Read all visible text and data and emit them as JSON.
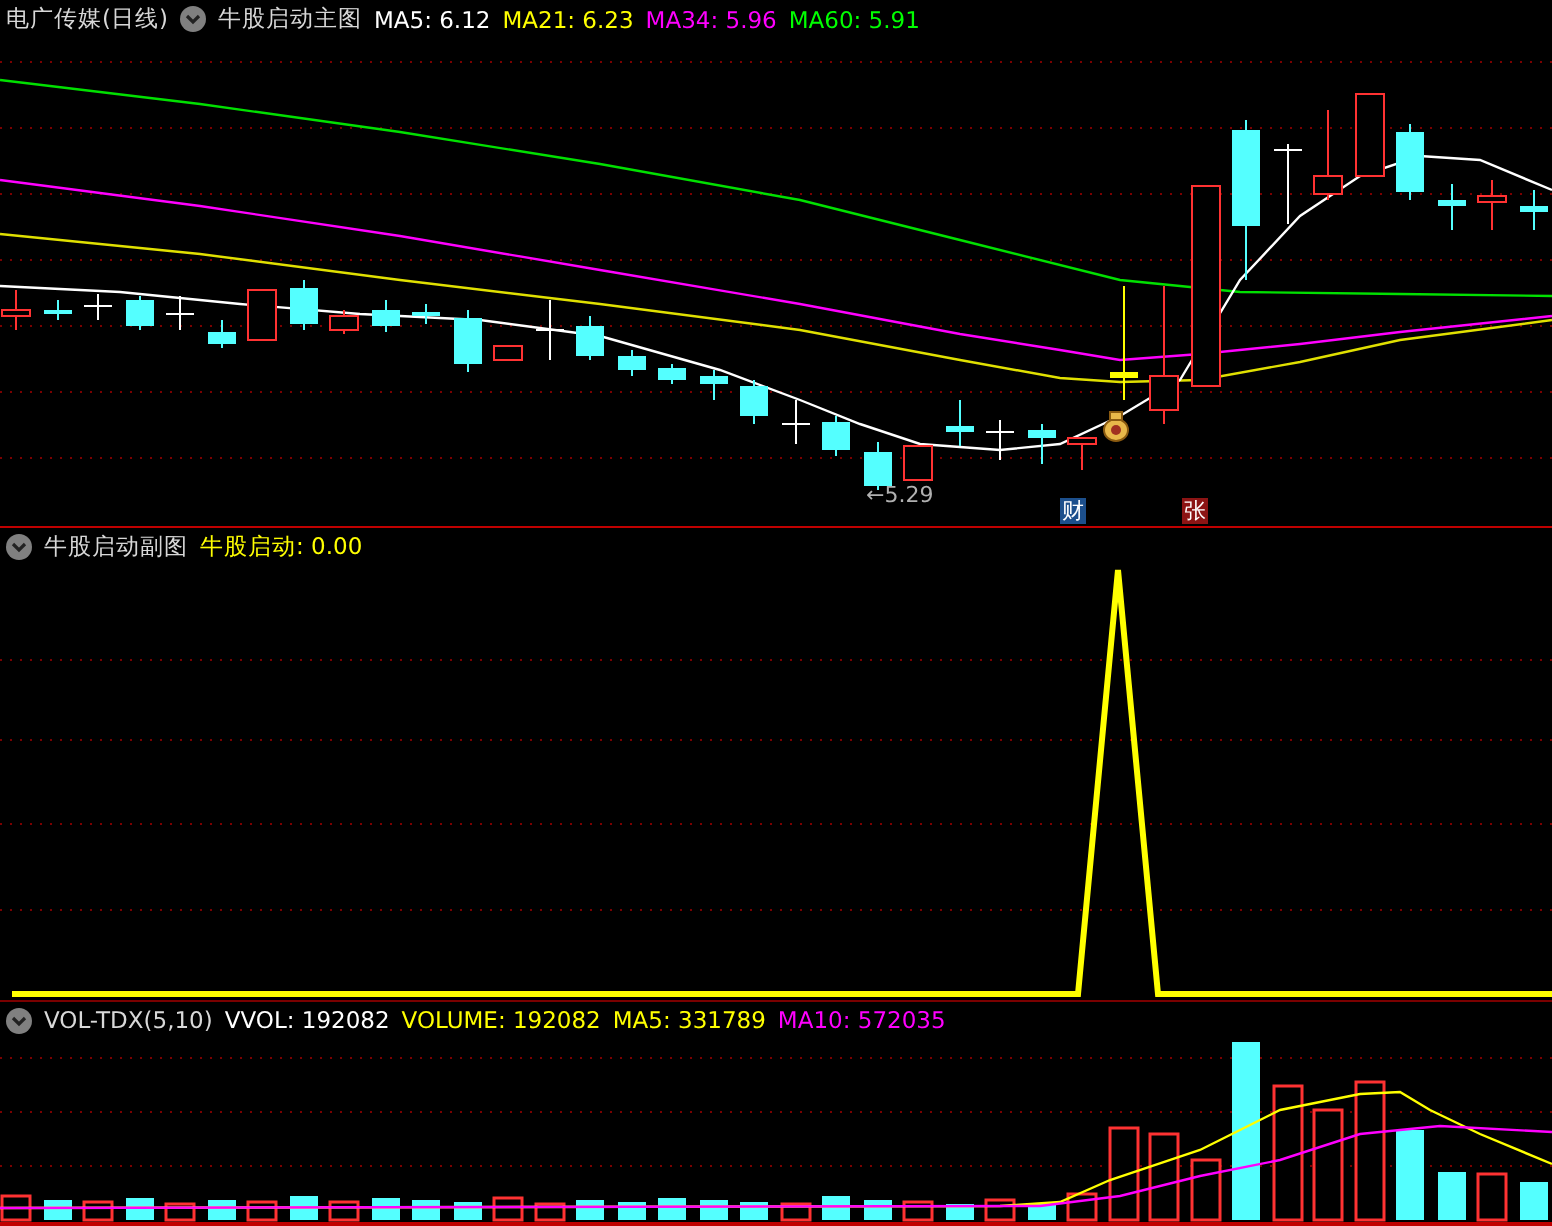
{
  "main_panel": {
    "stock_title": "电广传媒(日线)",
    "indicator_name": "牛股启动主图",
    "readings": [
      {
        "text": "MA5: 6.12",
        "color": "#ffffff"
      },
      {
        "text": "MA21: 6.23",
        "color": "#ffff00"
      },
      {
        "text": "MA34: 5.96",
        "color": "#ff00ff"
      },
      {
        "text": "MA60: 5.91",
        "color": "#00ff00"
      }
    ],
    "low_marker": "←5.29",
    "tags": [
      {
        "text": "财",
        "color": "#1c4f8c"
      },
      {
        "text": "张",
        "color": "#8c1414"
      }
    ]
  },
  "sub_panel": {
    "indicator_name": "牛股启动副图",
    "readings": [
      {
        "text": "牛股启动: 0.00",
        "color": "#ffff00"
      }
    ]
  },
  "volume_panel": {
    "indicator_name": "VOL-TDX(5,10)",
    "readings": [
      {
        "text": "VVOL: 192082",
        "color": "#ffffff"
      },
      {
        "text": "VOLUME: 192082",
        "color": "#ffff00"
      },
      {
        "text": "MA5: 331789",
        "color": "#ffff00"
      },
      {
        "text": "MA10: 572035",
        "color": "#ff00ff"
      }
    ]
  }
}
